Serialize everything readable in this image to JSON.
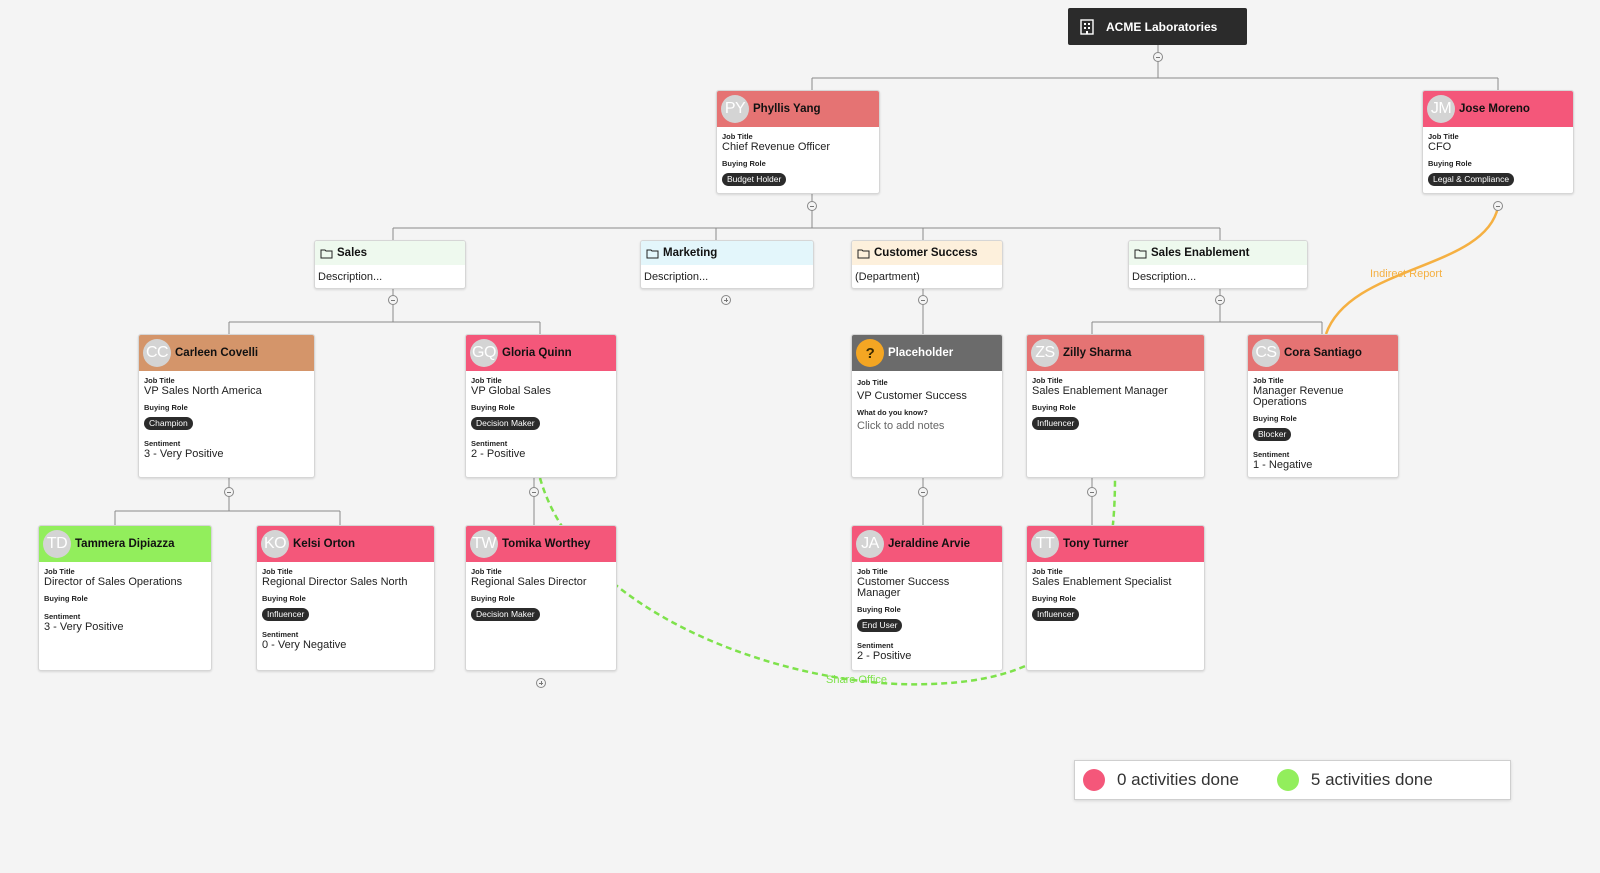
{
  "root": {
    "title": "ACME Laboratories",
    "icon": "building-icon"
  },
  "people": {
    "phyllis": {
      "initials": "PY",
      "name": "Phyllis Yang",
      "job_title_label": "Job Title",
      "job_title": "Chief Revenue Officer",
      "buying_role_label": "Buying Role",
      "buying_role": "Budget Holder"
    },
    "jose": {
      "initials": "JM",
      "name": "Jose Moreno",
      "job_title_label": "Job Title",
      "job_title": "CFO",
      "buying_role_label": "Buying Role",
      "buying_role": "Legal & Compliance"
    },
    "carleen": {
      "initials": "CC",
      "name": "Carleen Covelli",
      "job_title_label": "Job Title",
      "job_title": "VP Sales North America",
      "buying_role_label": "Buying Role",
      "buying_role": "Champion",
      "sentiment_label": "Sentiment",
      "sentiment": "3 - Very Positive"
    },
    "gloria": {
      "initials": "GQ",
      "name": "Gloria Quinn",
      "job_title_label": "Job Title",
      "job_title": "VP Global Sales",
      "buying_role_label": "Buying Role",
      "buying_role": "Decision Maker",
      "sentiment_label": "Sentiment",
      "sentiment": "2 - Positive"
    },
    "placeholder": {
      "initials": "?",
      "name": "Placeholder",
      "job_title_label": "Job Title",
      "job_title": "VP Customer Success",
      "know_label": "What do you know?",
      "know_value": "Click to add notes"
    },
    "zilly": {
      "initials": "ZS",
      "name": "Zilly Sharma",
      "job_title_label": "Job Title",
      "job_title": "Sales Enablement Manager",
      "buying_role_label": "Buying Role",
      "buying_role": "Influencer"
    },
    "cora": {
      "initials": "CS",
      "name": "Cora Santiago",
      "job_title_label": "Job Title",
      "job_title": "Manager Revenue Operations",
      "buying_role_label": "Buying Role",
      "buying_role": "Blocker",
      "sentiment_label": "Sentiment",
      "sentiment": "1 - Negative"
    },
    "tammera": {
      "initials": "TD",
      "name": "Tammera Dipiazza",
      "job_title_label": "Job Title",
      "job_title": "Director of Sales Operations",
      "buying_role_label": "Buying Role",
      "sentiment_label": "Sentiment",
      "sentiment": "3 - Very Positive"
    },
    "kelsi": {
      "initials": "KO",
      "name": "Kelsi Orton",
      "job_title_label": "Job Title",
      "job_title": "Regional Director Sales North",
      "buying_role_label": "Buying Role",
      "buying_role": "Influencer",
      "sentiment_label": "Sentiment",
      "sentiment": "0 - Very Negative"
    },
    "tomika": {
      "initials": "TW",
      "name": "Tomika Worthey",
      "job_title_label": "Job Title",
      "job_title": "Regional Sales Director",
      "buying_role_label": "Buying Role",
      "buying_role": "Decision Maker"
    },
    "jeraldine": {
      "initials": "JA",
      "name": "Jeraldine Arvie",
      "job_title_label": "Job Title",
      "job_title": "Customer Success Manager",
      "buying_role_label": "Buying Role",
      "buying_role": "End User",
      "sentiment_label": "Sentiment",
      "sentiment": "2 - Positive"
    },
    "tony": {
      "initials": "TT",
      "name": "Tony Turner",
      "job_title_label": "Job Title",
      "job_title": "Sales Enablement Specialist",
      "buying_role_label": "Buying Role",
      "buying_role": "Influencer"
    }
  },
  "departments": {
    "sales": {
      "name": "Sales",
      "description": "Description..."
    },
    "marketing": {
      "name": "Marketing",
      "description": "Description..."
    },
    "customer_success": {
      "name": "Customer Success",
      "description": "(Department)"
    },
    "sales_enablement": {
      "name": "Sales Enablement",
      "description": "Description..."
    }
  },
  "relationships": {
    "indirect_report": "Indirect Report",
    "share_office": "Share Office"
  },
  "legend": {
    "items": [
      {
        "label": "0 activities done",
        "color": "#f4577a"
      },
      {
        "label": "5 activities done",
        "color": "#92ee5c"
      }
    ]
  },
  "colors": {
    "red": "#f4577a",
    "salmon": "#e57373",
    "tan": "#d4956a",
    "green": "#92ee5c",
    "grey": "#6b6b6b",
    "sales_dept": "#eef9ee",
    "marketing_dept": "#e3f6fb",
    "cs_dept": "#fdf0dc",
    "indirect_line": "#f5b042",
    "share_line": "#7ee24b"
  }
}
